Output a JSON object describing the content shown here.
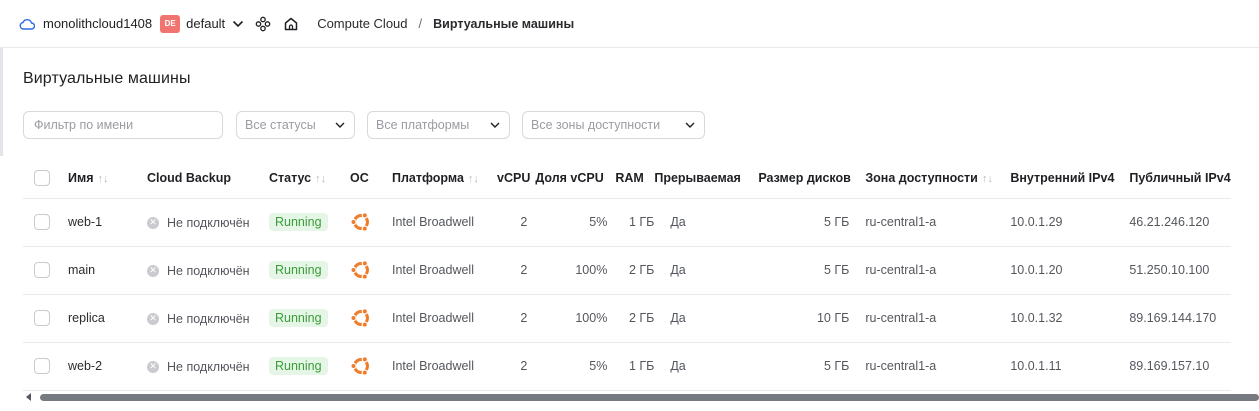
{
  "header": {
    "cloud_name": "monolithcloud1408",
    "folder_badge": "DE",
    "folder_name": "default",
    "breadcrumb": [
      "Compute Cloud",
      "/",
      "Виртуальные машины"
    ]
  },
  "page": {
    "title": "Виртуальные машины"
  },
  "filters": {
    "name_placeholder": "Фильтр по имени",
    "status_select": "Все статусы",
    "platform_select": "Все платформы",
    "zone_select": "Все зоны доступности"
  },
  "table": {
    "columns": {
      "name": "Имя",
      "backup": "Cloud Backup",
      "status": "Статус",
      "os": "ОС",
      "platform": "Платформа",
      "vcpu": "vCPU",
      "vcpu_share": "Доля vCPU",
      "ram": "RAM",
      "preemptible": "Прерываемая",
      "disk_size": "Размер дисков",
      "zone": "Зона доступности",
      "internal_ip": "Внутренний IPv4",
      "public_ip": "Публичный IPv4"
    },
    "rows": [
      {
        "name": "web-1",
        "backup": "Не подключён",
        "status": "Running",
        "platform": "Intel Broadwell",
        "vcpu": "2",
        "vcpu_share": "5%",
        "ram": "1 ГБ",
        "preemptible": "Да",
        "disk_size": "5 ГБ",
        "zone": "ru-central1-a",
        "internal_ip": "10.0.1.29",
        "public_ip": "46.21.246.120"
      },
      {
        "name": "main",
        "backup": "Не подключён",
        "status": "Running",
        "platform": "Intel Broadwell",
        "vcpu": "2",
        "vcpu_share": "100%",
        "ram": "2 ГБ",
        "preemptible": "Да",
        "disk_size": "5 ГБ",
        "zone": "ru-central1-a",
        "internal_ip": "10.0.1.20",
        "public_ip": "51.250.10.100"
      },
      {
        "name": "replica",
        "backup": "Не подключён",
        "status": "Running",
        "platform": "Intel Broadwell",
        "vcpu": "2",
        "vcpu_share": "100%",
        "ram": "2 ГБ",
        "preemptible": "Да",
        "disk_size": "10 ГБ",
        "zone": "ru-central1-a",
        "internal_ip": "10.0.1.32",
        "public_ip": "89.169.144.170"
      },
      {
        "name": "web-2",
        "backup": "Не подключён",
        "status": "Running",
        "platform": "Intel Broadwell",
        "vcpu": "2",
        "vcpu_share": "5%",
        "ram": "1 ГБ",
        "preemptible": "Да",
        "disk_size": "5 ГБ",
        "zone": "ru-central1-a",
        "internal_ip": "10.0.1.11",
        "public_ip": "89.169.157.10"
      }
    ]
  },
  "colors": {
    "running_bg": "#e6f6e6",
    "running_text": "#3a9c3a",
    "os_icon": "#f07b2b",
    "badge": "#f27470"
  },
  "icons": {
    "cloud": "cloud-icon",
    "services": "services-icon",
    "home": "home-icon",
    "os": "ubuntu-icon"
  }
}
